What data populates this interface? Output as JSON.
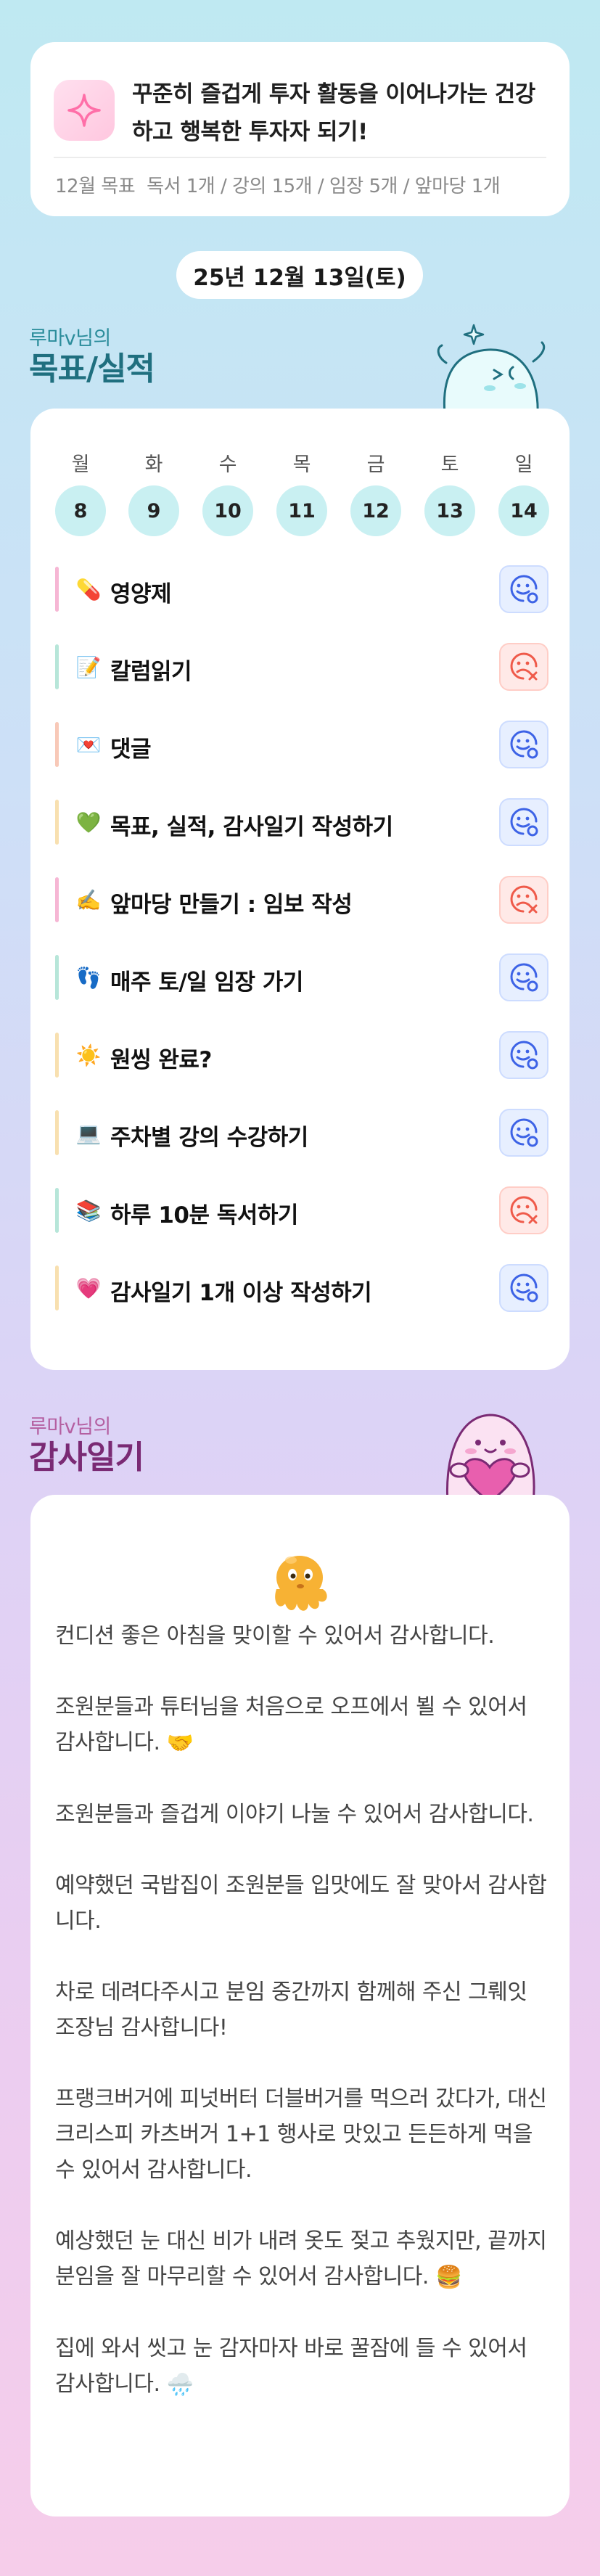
{
  "goal": {
    "text": "꾸준히 즐겁게 투자 활동을 이어나가는 건강하고 행복한 투자자 되기!",
    "month_label": "12월 목표",
    "month_items": "독서 1개 / 강의 15개 / 임장 5개 / 앞마당 1개",
    "icon": "sparkle-icon"
  },
  "date": "25년 12월 13일(토)",
  "achievements": {
    "header_small": "루마v님의",
    "header_big": "목표/실적",
    "weekdays": [
      "월",
      "화",
      "수",
      "목",
      "금",
      "토",
      "일"
    ],
    "days": [
      "8",
      "9",
      "10",
      "11",
      "12",
      "13",
      "14"
    ],
    "tasks": [
      {
        "label": "영양제",
        "emoji": "💊",
        "status": "done",
        "bar": "#f6b6d4"
      },
      {
        "label": "칼럼읽기",
        "emoji": "📝",
        "status": "missed",
        "bar": "#b7e6d9"
      },
      {
        "label": "댓글",
        "emoji": "💌",
        "status": "done",
        "bar": "#f8c9b8"
      },
      {
        "label": "목표, 실적, 감사일기 작성하기",
        "emoji": "💚",
        "status": "done",
        "bar": "#f8e0b0"
      },
      {
        "label": "앞마당 만들기 : 임보 작성",
        "emoji": "✍️",
        "status": "missed",
        "bar": "#f6b6d4"
      },
      {
        "label": "매주 토/일 임장 가기",
        "emoji": "👣",
        "status": "done",
        "bar": "#b7e6d9"
      },
      {
        "label": "원씽 완료?",
        "emoji": "☀️",
        "status": "done",
        "bar": "#f8e0b0"
      },
      {
        "label": "주차별 강의 수강하기",
        "emoji": "💻",
        "status": "done",
        "bar": "#f8e0b0"
      },
      {
        "label": "하루 10분 독서하기",
        "emoji": "📚",
        "status": "missed",
        "bar": "#b7e6d9"
      },
      {
        "label": "감사일기 1개 이상 작성하기",
        "emoji": "💗",
        "status": "done",
        "bar": "#f8e0b0"
      }
    ]
  },
  "gratitude": {
    "header_small": "루마v님의",
    "header_big": "감사일기",
    "items": [
      "컨디션 좋은 아침을 맞이할 수 있어서 감사합니다.",
      "조원분들과 튜터님을 처음으로 오프에서 뵐 수 있어서 감사합니다.",
      "조원분들과 즐겁게 이야기 나눌 수 있어서 감사합니다.",
      "예약했던 국밥집이 조원분들 입맛에도 잘 맞아서 감사합니다.",
      "차로 데려다주시고 분임 중간까지 함께해 주신 그뤠잇 조장님 감사합니다!",
      "프랭크버거에 피넛버터 더블버거를 먹으러 갔다가, 대신 크리스피 카츠버거 1+1 행사로 맛있고 든든하게 먹을 수 있어서 감사합니다.",
      "예상했던 눈 대신 비가 내려 옷도 젖고 추웠지만, 끝까지 분임을 잘 마무리할 수 있어서 감사합니다.",
      "집에 와서 씻고 눈 감자마자 바로 꿀잠에 들 수 있어서 감사합니다."
    ],
    "item_emojis": [
      "",
      "🤝",
      "",
      "",
      "",
      "",
      "🍔",
      "🌧️"
    ]
  }
}
